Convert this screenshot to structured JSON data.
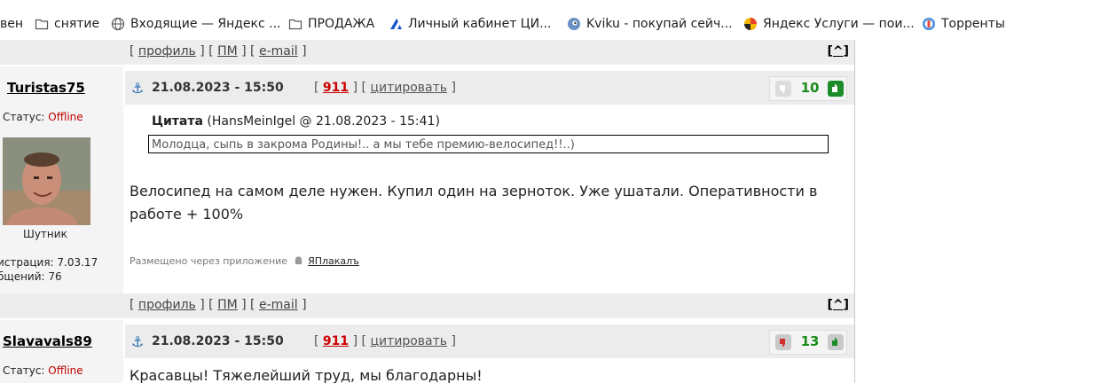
{
  "bookmarks": {
    "items": [
      {
        "label": "вен",
        "icon": ""
      },
      {
        "label": "снятие",
        "icon": "folder-icon"
      },
      {
        "label": "Входящие — Яндекс ...",
        "icon": "globe-icon"
      },
      {
        "label": "ПРОДАЖА",
        "icon": "folder-icon"
      },
      {
        "label": "Личный кабинет ЦИ...",
        "icon": "brand-mark-icon"
      },
      {
        "label": "Kviku - покупай сейч...",
        "icon": "kviku-icon"
      },
      {
        "label": "Яндекс Услуги — пои...",
        "icon": "yandex-services-icon"
      },
      {
        "label": "Торренты",
        "icon": "torrent-icon"
      }
    ]
  },
  "forum": {
    "links": {
      "open": "[",
      "profile": "профиль",
      "sep1": "] [",
      "pm": "ПМ",
      "sep2": "] [",
      "email": "e-mail",
      "close": "]"
    },
    "top": {
      "bracket_open": "[",
      "caret": "^",
      "bracket_close": "]"
    },
    "posts": [
      {
        "nick": "Turistas75",
        "date": "21.08.2023 - 15:50",
        "num": "911",
        "quote_label": "цитировать",
        "votes": "10",
        "status_label": "Статус:",
        "status_value": "Offline",
        "rank": "Шутник",
        "reg": "истрация: 7.03.17",
        "msgs": "бщений: 76",
        "quote_title": "Цитата",
        "quote_author": "(HansMeinIgel @ 21.08.2023 - 15:41)",
        "quote_text": "Молодца, сыпь в закрома Родины!.. а мы тебе премию-велосипед!!..)",
        "message": "Велосипед на самом деле нужен. Купил один на зерноток. Уже ушатали. Оперативности в работе + 100%",
        "via_label": "Размещено через приложение",
        "via_app": "ЯПлакалъ"
      },
      {
        "nick": "Slavavals89",
        "date": "21.08.2023 - 15:50",
        "num": "911",
        "quote_label": "цитировать",
        "votes": "13",
        "status_label": "Статус:",
        "status_value": "Offline",
        "message": "Красавцы! Тяжелейший труд, мы благодарны!"
      }
    ]
  },
  "colors": {
    "accent_red": "#cc0000",
    "vote_green": "#1a8a1a",
    "link": "#444444"
  }
}
